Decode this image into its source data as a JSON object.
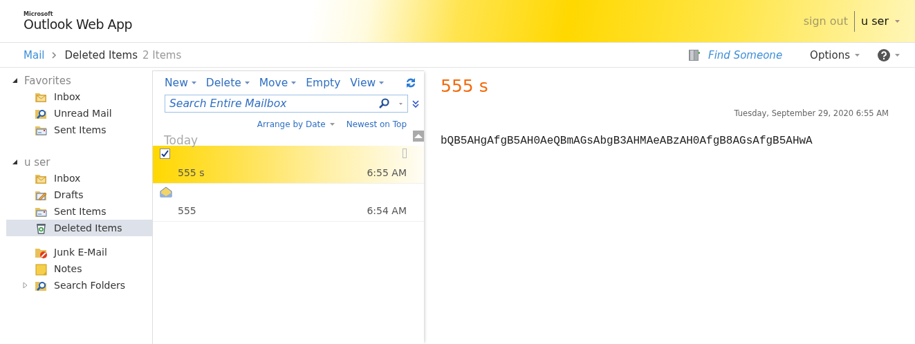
{
  "header": {
    "brand_small": "Microsoft",
    "brand": "Outlook Web App",
    "sign_out": "sign out",
    "user": "u ser"
  },
  "breadcrumb": {
    "root": "Mail",
    "folder": "Deleted Items",
    "count": "2 Items"
  },
  "top_actions": {
    "find": "Find Someone",
    "options": "Options"
  },
  "sidebar": {
    "groups": [
      {
        "title": "Favorites",
        "expanded": true,
        "items": [
          {
            "label": "Inbox",
            "kind": "inbox",
            "selected": false,
            "expandable": false
          },
          {
            "label": "Unread Mail",
            "kind": "search",
            "selected": false,
            "expandable": false
          },
          {
            "label": "Sent Items",
            "kind": "sent",
            "selected": false,
            "expandable": false
          }
        ]
      },
      {
        "title": "u ser",
        "expanded": true,
        "items": [
          {
            "label": "Inbox",
            "kind": "inbox",
            "selected": false,
            "expandable": false
          },
          {
            "label": "Drafts",
            "kind": "drafts",
            "selected": false,
            "expandable": false
          },
          {
            "label": "Sent Items",
            "kind": "sent",
            "selected": false,
            "expandable": false
          },
          {
            "label": "Deleted Items",
            "kind": "trash",
            "selected": true,
            "expandable": false
          },
          {
            "label": "Junk E-Mail",
            "kind": "junk",
            "selected": false,
            "expandable": false,
            "gap": true
          },
          {
            "label": "Notes",
            "kind": "notes",
            "selected": false,
            "expandable": false
          },
          {
            "label": "Search Folders",
            "kind": "search",
            "selected": false,
            "expandable": true
          }
        ]
      }
    ]
  },
  "toolbar": [
    {
      "label": "New",
      "dropdown": true
    },
    {
      "label": "Delete",
      "dropdown": true
    },
    {
      "label": "Move",
      "dropdown": true
    },
    {
      "label": "Empty",
      "dropdown": false
    },
    {
      "label": "View",
      "dropdown": true
    }
  ],
  "search": {
    "placeholder": "Search Entire Mailbox"
  },
  "sort": {
    "arrange": "Arrange by Date",
    "order": "Newest on Top"
  },
  "group_label": "Today",
  "messages": [
    {
      "subject": "555 s",
      "time": "6:55 AM",
      "selected": true
    },
    {
      "subject": "555",
      "time": "6:54 AM",
      "selected": false
    }
  ],
  "reading": {
    "subject": "555 s",
    "date": "Tuesday, September 29, 2020 6:55 AM",
    "body": "bQB5AHgAfgB5AH0AeQBmAGsAbgB3AHMAeABzAH0AfgB8AGsAfgB5AHwA"
  }
}
